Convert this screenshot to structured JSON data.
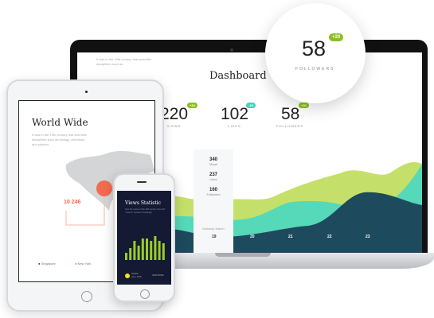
{
  "laptop": {
    "intro_text": "It was in the 19th century that scientific disciplines such as",
    "title": "Dashboard",
    "stats": [
      {
        "value": "220",
        "label": "VIEWS",
        "badge": "+34",
        "badge_color": "#8cbf1c"
      },
      {
        "value": "102",
        "label": "LIKES",
        "badge": "-15",
        "badge_color": "#3fd4c0"
      },
      {
        "value": "58",
        "label": "FOLLOWERS",
        "badge": "+20",
        "badge_color": "#8cbf1c"
      }
    ],
    "tooltip": {
      "items": [
        {
          "value": "340",
          "label": "Views"
        },
        {
          "value": "237",
          "label": "Likes"
        },
        {
          "value": "160",
          "label": "Followers"
        }
      ],
      "date": "Monday, March",
      "day": "19"
    },
    "x_labels": [
      "19",
      "20",
      "21",
      "22",
      "23"
    ]
  },
  "magnifier": {
    "value": "58",
    "label": "FOLLOWERS",
    "badge": "+20"
  },
  "tablet": {
    "title": "World Wide",
    "text": "It was in the 19th century that scientific disciplines such as biology, chemistry, and physics",
    "callout": "10 246",
    "legend": [
      {
        "label": "Singapore",
        "color": "#222"
      },
      {
        "label": "New York",
        "color": "#f26b4f"
      }
    ]
  },
  "phone": {
    "title": "Views Statistic",
    "text": "Over the course of the 19th century, the word \"science\" became increasingly",
    "bars": [
      3,
      5,
      8,
      6,
      9,
      9,
      8,
      10,
      8,
      7
    ],
    "legend_label": "Statistic",
    "legend_sub": "June, 2018",
    "right_label": "VIEW MORE"
  },
  "colors": {
    "lime": "#c5e06a",
    "teal": "#4fd8bd",
    "navy": "#1e4a5e",
    "accent": "#f26b4f"
  }
}
